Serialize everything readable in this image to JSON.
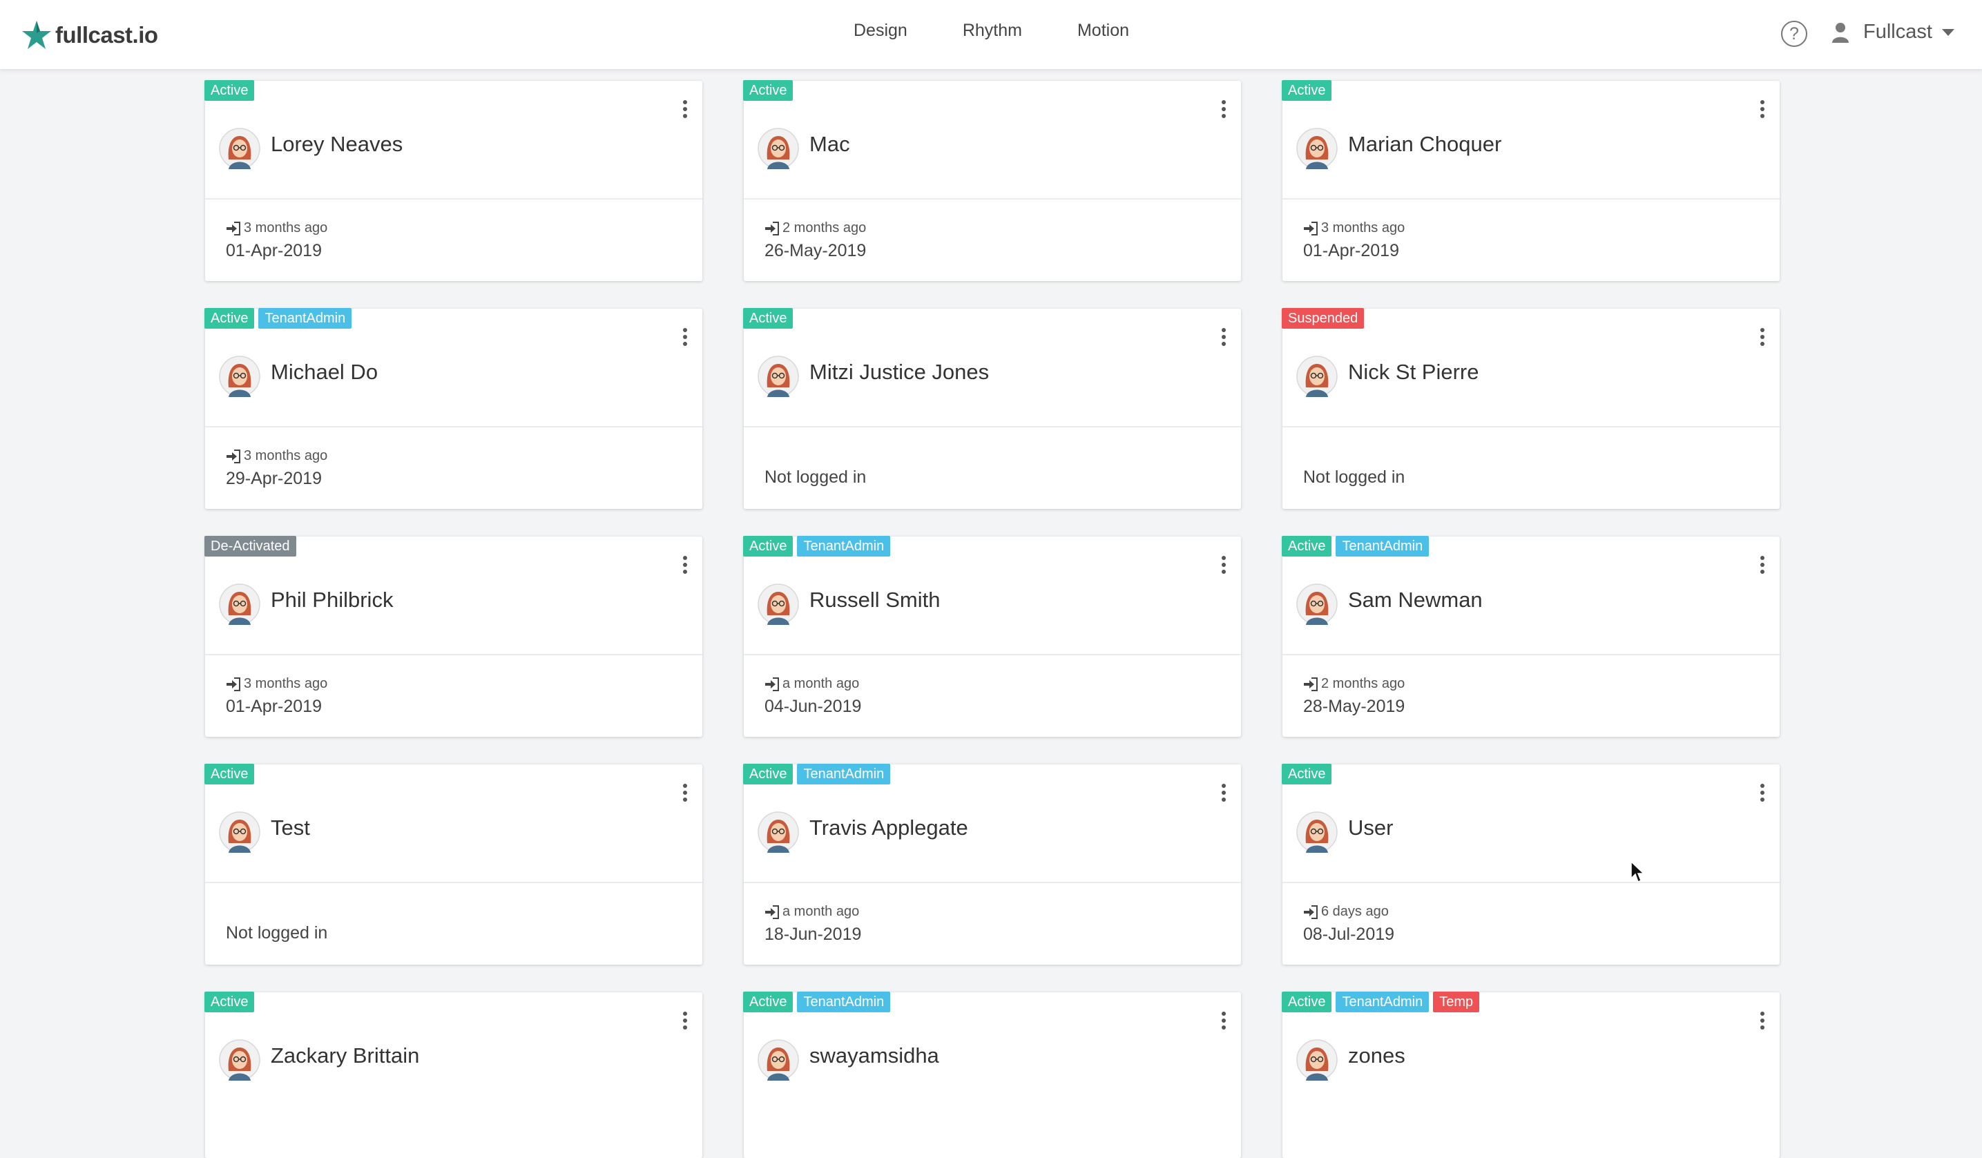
{
  "app": {
    "logo_text": "fullcast.io"
  },
  "nav": {
    "items": [
      "Design",
      "Rhythm",
      "Motion"
    ]
  },
  "header": {
    "help_symbol": "?",
    "user_name": "Fullcast"
  },
  "colors": {
    "active": "#33c4a0",
    "tenant_admin": "#4ac0e8",
    "suspended": "#ef5255",
    "deactivated": "#7f8990",
    "temp": "#ef5255"
  },
  "cards": [
    {
      "name": "Lorey Neaves",
      "badges": [
        "Active"
      ],
      "last_login": "3 months ago",
      "date": "01-Apr-2019"
    },
    {
      "name": "Mac",
      "badges": [
        "Active"
      ],
      "last_login": "2 months ago",
      "date": "26-May-2019"
    },
    {
      "name": "Marian Choquer",
      "badges": [
        "Active"
      ],
      "last_login": "3 months ago",
      "date": "01-Apr-2019"
    },
    {
      "name": "Michael Do",
      "badges": [
        "Active",
        "TenantAdmin"
      ],
      "last_login": "3 months ago",
      "date": "29-Apr-2019"
    },
    {
      "name": "Mitzi Justice Jones",
      "badges": [
        "Active"
      ],
      "not_logged": "Not logged in"
    },
    {
      "name": "Nick St Pierre",
      "badges": [
        "Suspended"
      ],
      "not_logged": "Not logged in"
    },
    {
      "name": "Phil Philbrick",
      "badges": [
        "De-Activated"
      ],
      "last_login": "3 months ago",
      "date": "01-Apr-2019"
    },
    {
      "name": "Russell Smith",
      "badges": [
        "Active",
        "TenantAdmin"
      ],
      "last_login": "a month ago",
      "date": "04-Jun-2019"
    },
    {
      "name": "Sam Newman",
      "badges": [
        "Active",
        "TenantAdmin"
      ],
      "last_login": "2 months ago",
      "date": "28-May-2019"
    },
    {
      "name": "Test",
      "badges": [
        "Active"
      ],
      "not_logged": "Not logged in"
    },
    {
      "name": "Travis Applegate",
      "badges": [
        "Active",
        "TenantAdmin"
      ],
      "last_login": "a month ago",
      "date": "18-Jun-2019"
    },
    {
      "name": "User",
      "badges": [
        "Active"
      ],
      "last_login": "6 days ago",
      "date": "08-Jul-2019"
    },
    {
      "name": "Zackary Brittain",
      "badges": [
        "Active"
      ]
    },
    {
      "name": "swayamsidha",
      "badges": [
        "Active",
        "TenantAdmin"
      ]
    },
    {
      "name": "zones",
      "badges": [
        "Active",
        "TenantAdmin",
        "Temp"
      ]
    }
  ]
}
